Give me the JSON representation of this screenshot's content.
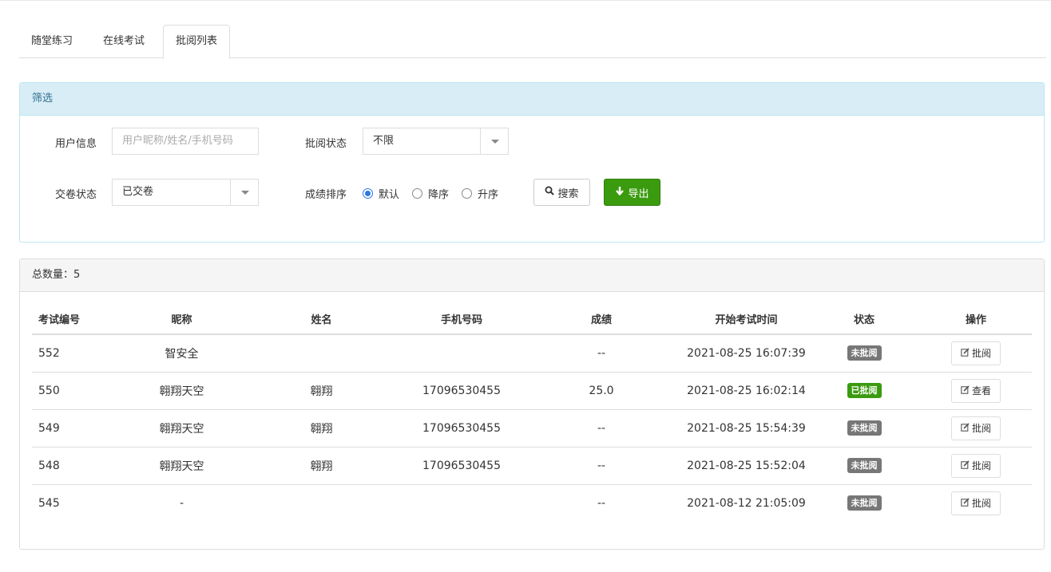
{
  "tabs": [
    {
      "label": "随堂练习",
      "active": false
    },
    {
      "label": "在线考试",
      "active": false
    },
    {
      "label": "批阅列表",
      "active": true
    }
  ],
  "filter": {
    "title": "筛选",
    "user_info_label": "用户信息",
    "user_info_placeholder": "用户昵称/姓名/手机号码",
    "review_status_label": "批阅状态",
    "review_status_value": "不限",
    "submit_status_label": "交卷状态",
    "submit_status_value": "已交卷",
    "sort_label": "成绩排序",
    "sort_options": [
      {
        "label": "默认",
        "checked": true
      },
      {
        "label": "降序",
        "checked": false
      },
      {
        "label": "升序",
        "checked": false
      }
    ],
    "search_label": "搜索",
    "export_label": "导出"
  },
  "list": {
    "total_text": "总数量：5",
    "columns": [
      "考试编号",
      "昵称",
      "姓名",
      "手机号码",
      "成绩",
      "开始考试时间",
      "状态",
      "操作"
    ],
    "rows": [
      {
        "id": "552",
        "nickname": "智安全",
        "name": "",
        "phone": "",
        "score": "--",
        "start_time": "2021-08-25 16:07:39",
        "status": "未批阅",
        "status_color": "#777777",
        "action": "批阅",
        "action_icon": "edit-icon"
      },
      {
        "id": "550",
        "nickname": "翱翔天空",
        "name": "翱翔",
        "phone": "17096530455",
        "score": "25.0",
        "start_time": "2021-08-25 16:02:14",
        "status": "已批阅",
        "status_color": "#3b9b0f",
        "action": "查看",
        "action_icon": "edit-icon"
      },
      {
        "id": "549",
        "nickname": "翱翔天空",
        "name": "翱翔",
        "phone": "17096530455",
        "score": "--",
        "start_time": "2021-08-25 15:54:39",
        "status": "未批阅",
        "status_color": "#777777",
        "action": "批阅",
        "action_icon": "edit-icon"
      },
      {
        "id": "548",
        "nickname": "翱翔天空",
        "name": "翱翔",
        "phone": "17096530455",
        "score": "--",
        "start_time": "2021-08-25 15:52:04",
        "status": "未批阅",
        "status_color": "#777777",
        "action": "批阅",
        "action_icon": "edit-icon"
      },
      {
        "id": "545",
        "nickname": "-",
        "name": "",
        "phone": "",
        "score": "--",
        "start_time": "2021-08-12 21:05:09",
        "status": "未批阅",
        "status_color": "#777777",
        "action": "批阅",
        "action_icon": "edit-icon"
      }
    ]
  }
}
